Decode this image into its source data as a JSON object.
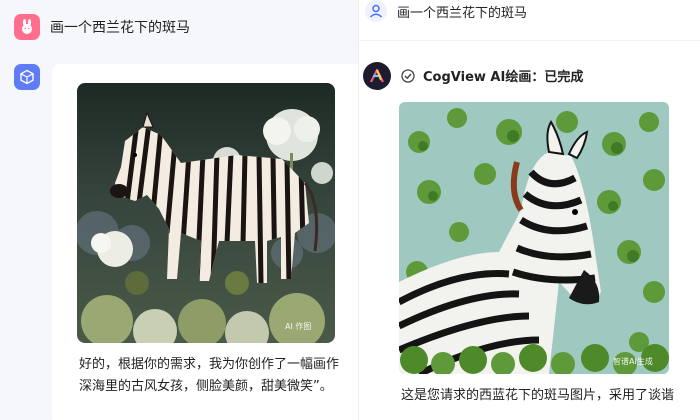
{
  "left": {
    "prompt": "画一个西兰花下的斑马",
    "image_watermark": "AI 作图",
    "response_line1": "好的，根据你的需求，我为你创作了一幅画作",
    "response_line2": "深海里的古风女孩，侧脸美颜，甜美微笑”。"
  },
  "right": {
    "prompt": "画一个西兰花下的斑马",
    "status": "CogView AI绘画：已完成",
    "image_watermark": "智谱AI生成",
    "response": "这是您请求的西蓝花下的斑马图片，采用了谈谐"
  },
  "colors": {
    "left_user_avatar": "#ff6f8d",
    "left_bot_avatar": "#5f7cf6",
    "right_bot_avatar": "#1c1c2e"
  }
}
